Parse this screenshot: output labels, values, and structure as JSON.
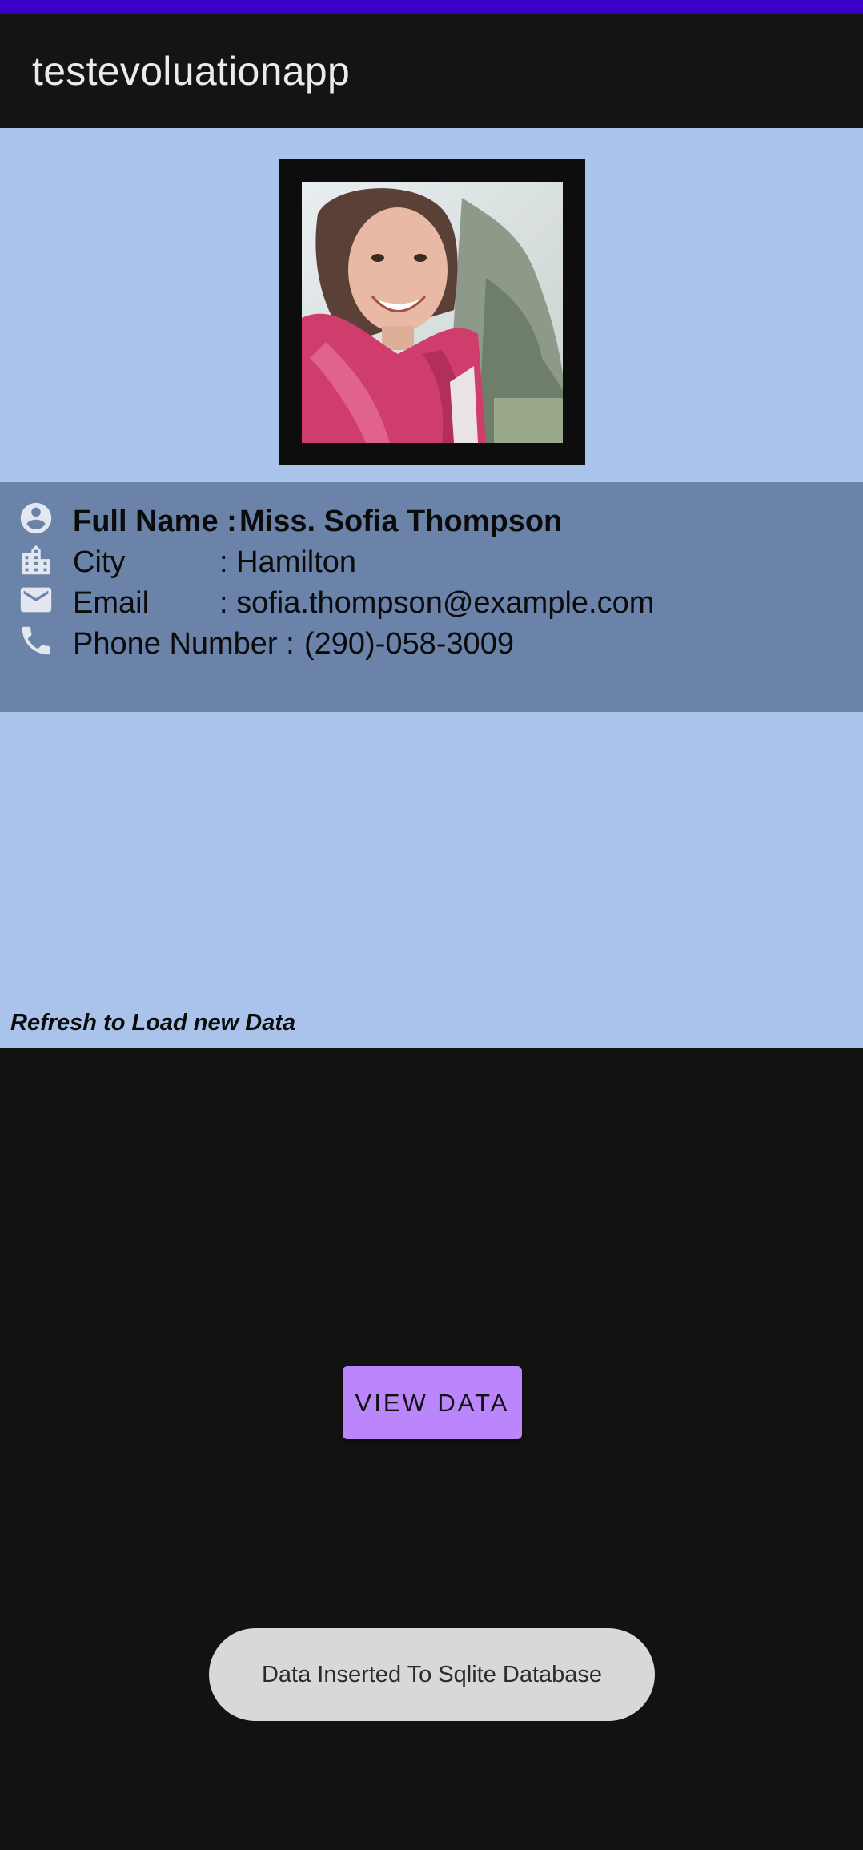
{
  "app": {
    "title": "testevoluationapp"
  },
  "profile": {
    "photo_alt": "profile-photo",
    "full_name": {
      "label": "Full Name : ",
      "value": "Miss. Sofia Thompson",
      "icon": "account-circle-icon"
    },
    "city": {
      "label": "City",
      "value": ": Hamilton",
      "icon": "city-building-icon"
    },
    "email": {
      "label": "Email",
      "value": ": sofia.thompson@example.com",
      "icon": "email-icon"
    },
    "phone": {
      "label": "Phone Number : ",
      "value": "(290)-058-3009",
      "icon": "phone-icon"
    }
  },
  "refresh_hint": "Refresh to Load new Data",
  "actions": {
    "view_data_label": "VIEW DATA"
  },
  "toast": {
    "message": "Data Inserted To Sqlite Database"
  },
  "colors": {
    "status_bar": "#3a00c8",
    "app_bar": "#141414",
    "photo_background": "#aac3ea",
    "info_background": "#6b83a8",
    "button": "#bb86fc",
    "toast": "#d8d8d8",
    "screen_background": "#121212"
  }
}
